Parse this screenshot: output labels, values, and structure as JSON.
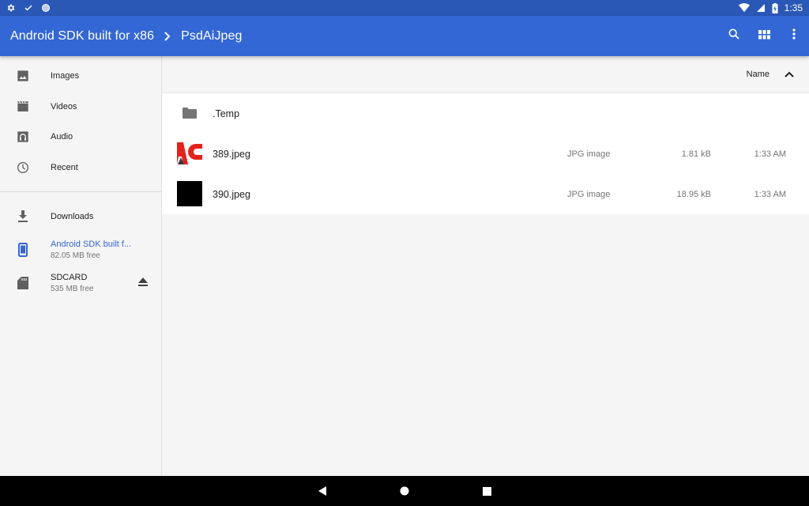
{
  "status_bar": {
    "time": "1:35",
    "icons": [
      "gear-icon",
      "check-icon",
      "circle-icon",
      "wifi-icon",
      "signal-icon",
      "battery-icon"
    ]
  },
  "app_bar": {
    "breadcrumb": [
      "Android SDK built for x86",
      "PsdAiJpeg"
    ],
    "actions": [
      "search-icon",
      "grid-view-icon",
      "more-options-icon"
    ],
    "color": "#3367d6"
  },
  "sidebar": {
    "items": [
      {
        "label": "Images",
        "icon": "image-icon"
      },
      {
        "label": "Videos",
        "icon": "video-icon"
      },
      {
        "label": "Audio",
        "icon": "audio-icon"
      },
      {
        "label": "Recent",
        "icon": "clock-icon"
      }
    ],
    "roots": [
      {
        "label": "Downloads",
        "sub": "",
        "icon": "download-icon"
      },
      {
        "label": "Android SDK built f...",
        "sub": "82.05 MB free",
        "icon": "phone-icon",
        "active": true
      },
      {
        "label": "SDCARD",
        "sub": "535 MB free",
        "icon": "sdcard-icon",
        "eject": true
      }
    ]
  },
  "main": {
    "sort": {
      "label": "Name",
      "direction": "ascending"
    },
    "files": [
      {
        "name": ".Temp",
        "type": "",
        "size": "",
        "date": "",
        "kind": "folder"
      },
      {
        "name": "389.jpeg",
        "type": "JPG image",
        "size": "1.81 kB",
        "date": "1:33 AM",
        "kind": "image-red"
      },
      {
        "name": "390.jpeg",
        "type": "JPG image",
        "size": "18.95 kB",
        "date": "1:33 AM",
        "kind": "image-black"
      }
    ]
  },
  "nav_bar": {
    "buttons": [
      "back-icon",
      "home-icon",
      "recents-icon"
    ]
  }
}
